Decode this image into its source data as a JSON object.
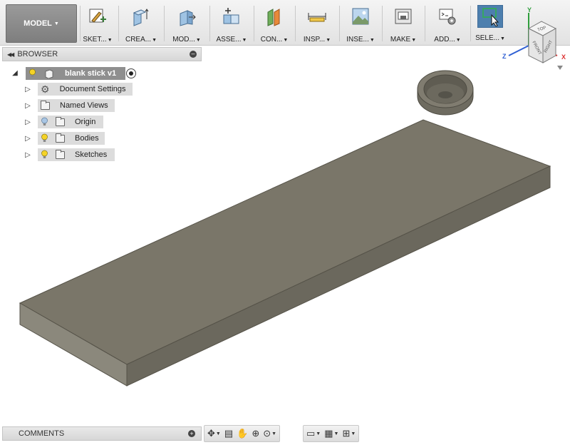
{
  "toolbar": {
    "workspace": "MODEL",
    "groups": [
      {
        "label": "SKET...",
        "icon": "sketch-icon"
      },
      {
        "label": "CREA...",
        "icon": "create-box-icon"
      },
      {
        "label": "MOD...",
        "icon": "modify-icon"
      },
      {
        "label": "ASSE...",
        "icon": "assemble-icon"
      },
      {
        "label": "CON...",
        "icon": "construct-icon"
      },
      {
        "label": "INSP...",
        "icon": "inspect-ruler-icon"
      },
      {
        "label": "INSE...",
        "icon": "insert-image-icon"
      },
      {
        "label": "MAKE",
        "icon": "make-printer-icon"
      },
      {
        "label": "ADD...",
        "icon": "addins-icon"
      },
      {
        "label": "SELE...",
        "icon": "select-cursor-icon"
      }
    ]
  },
  "browser": {
    "title": "BROWSER",
    "root": {
      "label": "blank stick v1"
    },
    "items": [
      {
        "label": "Document Settings",
        "icon": "gear-icon"
      },
      {
        "label": "Named Views",
        "icon": "folder-icon"
      },
      {
        "label": "Origin",
        "icon": "folder-icon",
        "bulb": "hidden"
      },
      {
        "label": "Bodies",
        "icon": "folder-icon",
        "bulb": "visible"
      },
      {
        "label": "Sketches",
        "icon": "folder-icon",
        "bulb": "visible"
      }
    ]
  },
  "viewcube": {
    "faces": {
      "top": "TOP",
      "front": "FRONT",
      "right": "RIGHT"
    },
    "axes": {
      "x": "X",
      "y": "Y",
      "z": "Z"
    }
  },
  "comments": {
    "title": "COMMENTS"
  },
  "colors": {
    "accent": "#4d7fae",
    "model_top": "#7a7669",
    "model_front": "#8a877b",
    "model_side": "#6c695d",
    "bulb_on": "#f5d327",
    "bulb_off": "#a9c6e4"
  }
}
